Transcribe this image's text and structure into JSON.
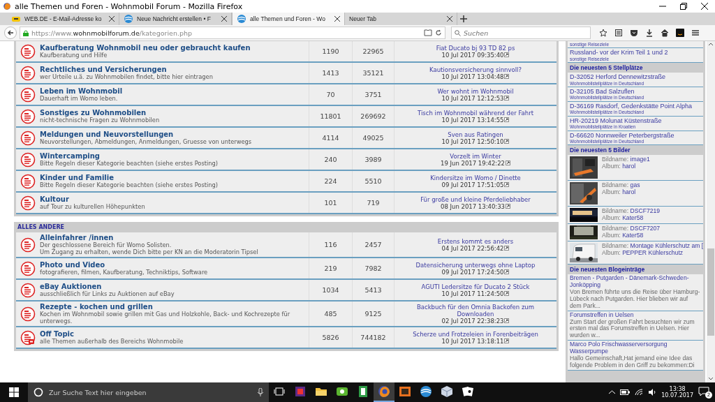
{
  "window": {
    "title": "alle Themen und Foren - Wohnmobil Forum - Mozilla Firefox"
  },
  "tabs": [
    {
      "label": "WEB.DE - E-Mail-Adresse ko",
      "selected": false,
      "kind": "webde"
    },
    {
      "label": "Neue Nachricht erstellen • F",
      "selected": false,
      "kind": "forum"
    },
    {
      "label": "alle Themen und Foren - Wo",
      "selected": true,
      "kind": "forum"
    },
    {
      "label": "Neuer Tab",
      "selected": false,
      "kind": "blank"
    }
  ],
  "nav": {
    "url_scheme": "https://www.",
    "url_host": "wohnmobilforum.de",
    "url_path": "/kategorien.php",
    "search_placeholder": "Suchen"
  },
  "sections": [
    {
      "forums": [
        {
          "kind": "normal",
          "name": "Kaufberatung Wohnmobil neu oder gebraucht kaufen",
          "description": [
            "Kaufberatung und Hilfe"
          ],
          "topics": "1190",
          "posts": "22965",
          "last_title": "Fiat Ducato bj 93 TD 82 ps",
          "last_date": "10 Jul 2017 09:35:40"
        },
        {
          "kind": "normal",
          "name": "Rechtliches und Versicherungen",
          "description": [
            "wer Urteile u.ä. zu Wohnmobilen findet, bitte hier eintragen"
          ],
          "topics": "1413",
          "posts": "35121",
          "last_title": "Kautionsversicherung sinnvoll?",
          "last_date": "10 Jul 2017 13:04:48"
        },
        {
          "kind": "normal",
          "name": "Leben im Wohnmobil",
          "description": [
            "Dauerhaft im Womo leben."
          ],
          "topics": "70",
          "posts": "3751",
          "last_title": "Wer wohnt im Wohnmobil",
          "last_date": "10 Jul 2017 12:12:53"
        },
        {
          "kind": "normal",
          "name": "Sonstiges zu Wohnmobilen",
          "description": [
            "nicht-technische Fragen zu Wohnmobilen"
          ],
          "topics": "11801",
          "posts": "269692",
          "last_title": "Tisch im Wohnmobil während der Fahrt",
          "last_date": "10 Jul 2017 13:14:55"
        },
        {
          "kind": "normal",
          "name": "Meldungen und Neuvorstellungen",
          "description": [
            "Neuvorstellungen, Abmeldungen, Anmeldungen, Gruesse von unterwegs"
          ],
          "topics": "4114",
          "posts": "49025",
          "last_title": "Sven aus Ratingen",
          "last_date": "10 Jul 2017 12:50:10"
        },
        {
          "kind": "normal",
          "name": "Wintercamping",
          "description": [
            "Bitte Regeln dieser Kategorie beachten (siehe erstes Posting)"
          ],
          "topics": "240",
          "posts": "3989",
          "last_title": "Vorzelt im Winter",
          "last_date": "19 Jun 2017 19:42:22"
        },
        {
          "kind": "normal",
          "name": "Kinder und Familie",
          "description": [
            "Bitte Regeln dieser Kategorie beachten (siehe erstes Posting)"
          ],
          "topics": "224",
          "posts": "5510",
          "last_title": "Kindersitze im Womo / Dinette",
          "last_date": "09 Jul 2017 17:51:05"
        },
        {
          "kind": "normal",
          "name": "Kultour",
          "description": [
            "auf Tour zu kulturellen Höhepunkten"
          ],
          "topics": "101",
          "posts": "719",
          "last_title": "Für große und kleine Pferdeliebhaber",
          "last_date": "08 Jun 2017 13:40:33"
        }
      ]
    },
    {
      "title": "ALLES ANDERE",
      "forums": [
        {
          "kind": "normal",
          "name": "Alleinfahrer /innen",
          "description": [
            "Der geschlossene Bereich für Womo Solisten.",
            "Um Zugang zu erhalten, wende Dich bitte per KN an die Moderatorin Tipsel"
          ],
          "topics": "116",
          "posts": "2457",
          "last_title": "Erstens kommt es anders",
          "last_date": "04 Jul 2017 22:56:42"
        },
        {
          "kind": "normal",
          "name": "Photo und Video",
          "description": [
            "fotografieren, filmen, Kaufberatung, Techniktips, Software"
          ],
          "topics": "219",
          "posts": "7982",
          "last_title": "Datensicherung unterwegs ohne Laptop",
          "last_date": "09 Jul 2017 17:24:50"
        },
        {
          "kind": "normal",
          "name": "eBay Auktionen",
          "description": [
            "ausschließlich für Links zu Auktionen auf eBay"
          ],
          "topics": "1034",
          "posts": "5413",
          "last_title": "AGUTI Ledersitze für Ducato 2 Stück",
          "last_date": "10 Jul 2017 11:24:50"
        },
        {
          "kind": "normal",
          "name": "Rezepte - kochen und grillen",
          "description": [
            "Kochen im Wohnmobil sowie grillen mit Gas und Holzkohle, Back- und Kochrezepte für",
            "unterwegs."
          ],
          "topics": "485",
          "posts": "9125",
          "last_title": "Backbuch für den Omnia Backofen zum Downloaden",
          "last_date": "02 Jul 2017 22:38:23"
        },
        {
          "kind": "offtopic",
          "name": "Off Topic",
          "description": [
            "alle Themen außerhalb des Bereichs Wohnmobile"
          ],
          "topics": "5826",
          "posts": "744182",
          "last_title": "Scherze und Frotzeleien in Forenbeiträgen",
          "last_date": "10 Jul 2017 13:18:11"
        }
      ]
    }
  ],
  "sidebar": [
    {
      "kind": "sub",
      "sub": "sonstige Reiseziele"
    },
    {
      "kind": "link",
      "title": "Russland- vor der Krim Teil 1 und 2",
      "sub": "sonstige Reiseziele"
    },
    {
      "kind": "header",
      "title": "Die neuesten 5 Stellplätze"
    },
    {
      "kind": "link",
      "title": "D-32052 Herford Dennewitzstraße",
      "sub": "Wohnmobilstellplätze in Deutschland"
    },
    {
      "kind": "link",
      "title": "D-32105 Bad Salzuflen",
      "sub": "Wohnmobilstellplätze in Deutschland"
    },
    {
      "kind": "link",
      "title": "D-36169 Rasdorf, Gedenkstätte Point Alpha",
      "sub": "Wohnmobilstellplätze in Deutschland"
    },
    {
      "kind": "link",
      "title": "HR-20219 Molunat Küstenstraße",
      "sub": "Wohnmobilstellplätze in Kroatien"
    },
    {
      "kind": "link",
      "title": "D-66620 Nonnweiler Peterbergstraße",
      "sub": "Wohnmobilstellplätze in Deutschland"
    },
    {
      "kind": "header",
      "title": "Die neuesten 5 Bilder"
    },
    {
      "name_label": "Bildname:",
      "name": "image1",
      "album_label": "Album:",
      "album": "harol"
    },
    {
      "name_label": "Bildname:",
      "name": "gas",
      "album_label": "Album:",
      "album": "harol"
    },
    {
      "name_label": "Bildname:",
      "name": "DSCF7219",
      "album_label": "Album:",
      "album": "Kater58"
    },
    {
      "name_label": "Bildname:",
      "name": "DSCF7207",
      "album_label": "Album:",
      "album": "Kater58"
    },
    {
      "name_label": "Bildname:",
      "name": "Montage Kühlerschutz am [",
      "album_label": "Album:",
      "album": "PEPPER Kühlerschutz"
    },
    {
      "kind": "header",
      "title": "Die neuesten Blogeinträge"
    },
    {
      "kind": "blog",
      "title": "Bremen - Putgarden - Dänemark-Schweden-Jonköpping",
      "text": "Von Bremen führte uns die Reise über Hamburg-Lübeck nach Putgarden. Hier blieben wir auf dem Park..."
    },
    {
      "kind": "blog",
      "title": "Forumstreffen in Uelsen",
      "text": "Zum Start der großen Fahrt besuchten wir zum ersten mal das Forumstreffen in Uelsen. Hier wurden w..."
    },
    {
      "kind": "blog",
      "title": "Marco Polo Frischwasserversorgung Wasserpumpe",
      "text": "Hallo Gemeinschaft,Hat jemand eine Idee das folgende Problem in den Griff zu bekommen:Di"
    }
  ],
  "taskbar": {
    "search_placeholder": "Zur Suche Text hier eingeben",
    "apps": [
      {
        "kind": "app-red",
        "selected": false
      },
      {
        "kind": "folder",
        "selected": false
      },
      {
        "kind": "app-green",
        "selected": false
      },
      {
        "kind": "app-book",
        "selected": false
      },
      {
        "kind": "firefox",
        "selected": true
      },
      {
        "kind": "app-orange",
        "selected": false
      },
      {
        "kind": "app-blue",
        "selected": false
      },
      {
        "kind": "app-cube",
        "selected": false
      },
      {
        "kind": "cards",
        "selected": false
      }
    ],
    "time": "13:38",
    "date": "10.07.2017",
    "notifications": "2"
  }
}
